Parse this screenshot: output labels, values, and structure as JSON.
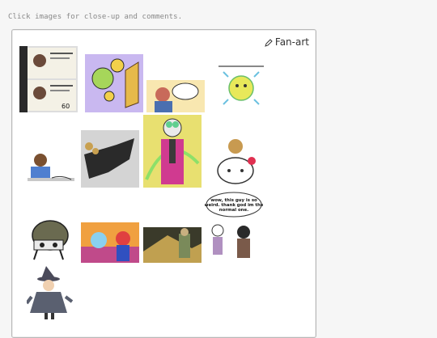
{
  "page": {
    "hint": "Click images for close-up and comments."
  },
  "gallery": {
    "title": "Fan-art",
    "title_icon": "pencil-icon",
    "items": [
      {
        "name": "thumb-poster-collage"
      },
      {
        "name": "thumb-sun-doodles"
      },
      {
        "name": "thumb-comic-panel"
      },
      {
        "name": "thumb-sun-character"
      },
      {
        "name": "thumb-desk-character"
      },
      {
        "name": "thumb-dark-creature"
      },
      {
        "name": "thumb-pink-suit-character"
      },
      {
        "name": "thumb-hello-kitty-character"
      },
      {
        "name": "thumb-helmet-creature"
      },
      {
        "name": "thumb-colorful-pair"
      },
      {
        "name": "thumb-dark-scene"
      },
      {
        "name": "thumb-speech-bubble-comic",
        "caption": "wow, this guy is so weird. thank god im the normal one."
      },
      {
        "name": "thumb-wizard-character"
      }
    ]
  }
}
